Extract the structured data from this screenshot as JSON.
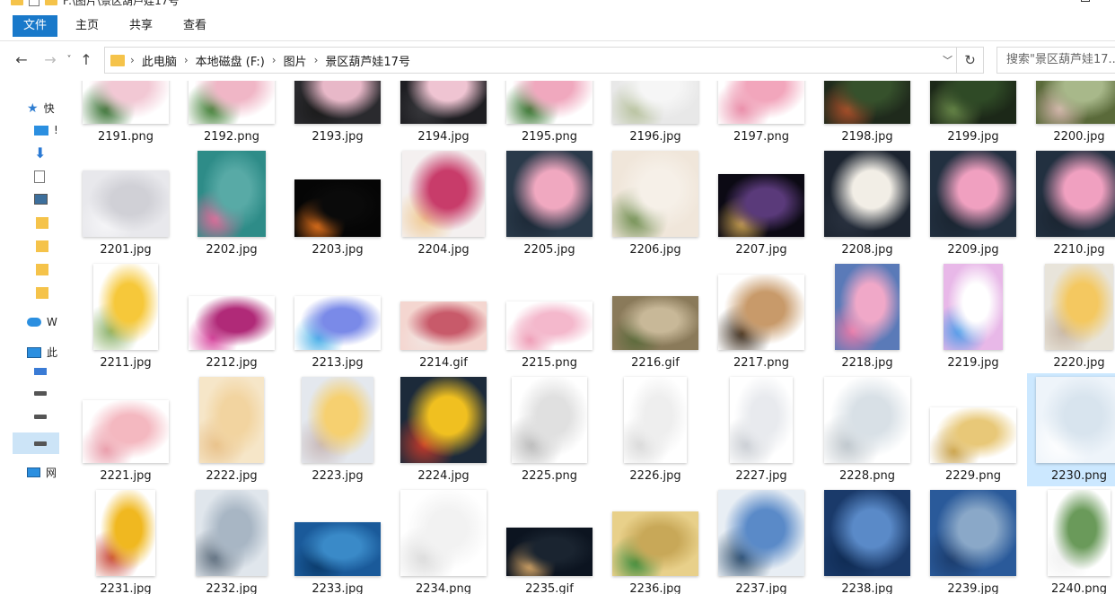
{
  "title_path": "F:\\图片\\景区葫芦娃17号",
  "ribbon": {
    "tabs": [
      "文件",
      "主页",
      "共享",
      "查看"
    ]
  },
  "nav": {
    "back": "←",
    "forward": "→",
    "recent": "˅",
    "up": "↑"
  },
  "address": {
    "crumbs": [
      "此电脑",
      "本地磁盘 (F:)",
      "图片",
      "景区葫芦娃17号"
    ],
    "dropdown_icon": "chevron-down-icon",
    "refresh_icon": "refresh-icon"
  },
  "search": {
    "placeholder": "搜索\"景区葫芦娃17..."
  },
  "sidebar": {
    "items": [
      {
        "icon": "star-icon",
        "label": "快"
      },
      {
        "icon": "desktop-icon",
        "label": "!"
      },
      {
        "icon": "download-icon",
        "label": ""
      },
      {
        "icon": "document-icon",
        "label": ""
      },
      {
        "icon": "picture-icon",
        "label": ""
      },
      {
        "icon": "folder-icon",
        "label": ""
      },
      {
        "icon": "folder-icon",
        "label": ""
      },
      {
        "icon": "folder-icon",
        "label": ""
      },
      {
        "icon": "folder-icon",
        "label": ""
      },
      {
        "icon": "cloud-icon",
        "label": "W"
      },
      {
        "icon": "pc-icon",
        "label": "此"
      },
      {
        "icon": "windows-drive-icon",
        "label": ""
      },
      {
        "icon": "drive-icon",
        "label": ""
      },
      {
        "icon": "drive-icon",
        "label": ""
      },
      {
        "icon": "drive-icon",
        "label": ""
      },
      {
        "icon": "network-icon",
        "label": "网"
      }
    ]
  },
  "files": [
    {
      "name": "2191.png",
      "colors": [
        "#ffffff",
        "#f2c8d4",
        "#2f6b2a"
      ]
    },
    {
      "name": "2192.png",
      "colors": [
        "#ffffff",
        "#f0b6c6",
        "#3a7a2e"
      ]
    },
    {
      "name": "2193.jpg",
      "colors": [
        "#2a2a2e",
        "#e8b8c8",
        "#1a1a1a"
      ]
    },
    {
      "name": "2194.jpg",
      "colors": [
        "#1e1e22",
        "#efc4d2",
        "#3a3a3e"
      ]
    },
    {
      "name": "2195.png",
      "colors": [
        "#ffffff",
        "#f0a8be",
        "#2e6e26"
      ]
    },
    {
      "name": "2196.jpg",
      "colors": [
        "#e8e8e8",
        "#f6f6f6",
        "#b5c09a"
      ]
    },
    {
      "name": "2197.png",
      "colors": [
        "#ffffff",
        "#f2a6bc",
        "#e88aa6"
      ]
    },
    {
      "name": "2198.jpg",
      "colors": [
        "#1f2a1c",
        "#36512c",
        "#b0502a"
      ]
    },
    {
      "name": "2199.jpg",
      "colors": [
        "#1c2818",
        "#2f4a26",
        "#6a8a4a"
      ]
    },
    {
      "name": "2200.jpg",
      "colors": [
        "#5a6a3a",
        "#a8b88a",
        "#d8b8b0"
      ]
    },
    {
      "name": "2201.jpg",
      "colors": [
        "#e8e8ec",
        "#d0d0d6",
        "#f6f6f8"
      ]
    },
    {
      "name": "2202.jpg",
      "colors": [
        "#2e8c88",
        "#58aaa6",
        "#e86a9a"
      ]
    },
    {
      "name": "2203.jpg",
      "colors": [
        "#050505",
        "#0a0a0a",
        "#e8741c"
      ]
    },
    {
      "name": "2204.jpg",
      "colors": [
        "#f4f0f0",
        "#c83c6a",
        "#f0c890"
      ]
    },
    {
      "name": "2205.jpg",
      "colors": [
        "#2a3a4a",
        "#f0a8c0",
        "#1c2836"
      ]
    },
    {
      "name": "2206.jpg",
      "colors": [
        "#f0e6da",
        "#f6f0e8",
        "#6a8a4a"
      ]
    },
    {
      "name": "2207.jpg",
      "colors": [
        "#0c0a14",
        "#5a3a7a",
        "#c8a050"
      ]
    },
    {
      "name": "2208.jpg",
      "colors": [
        "#1c2430",
        "#f2eee6",
        "#2a3240"
      ]
    },
    {
      "name": "2209.jpg",
      "colors": [
        "#223040",
        "#f0a0c0",
        "#1a2430"
      ]
    },
    {
      "name": "2210.jpg",
      "colors": [
        "#223040",
        "#f0a0c0",
        "#1a2430"
      ]
    },
    {
      "name": "2211.jpg",
      "colors": [
        "#ffffff",
        "#f6c83a",
        "#8ab068"
      ]
    },
    {
      "name": "2212.jpg",
      "colors": [
        "#ffffff",
        "#b02a78",
        "#d84aa0"
      ]
    },
    {
      "name": "2213.jpg",
      "colors": [
        "#ffffff",
        "#7a8ae8",
        "#4ab0e8"
      ]
    },
    {
      "name": "2214.gif",
      "colors": [
        "#f4d6d0",
        "#c85a6a",
        "#f2e4e0"
      ]
    },
    {
      "name": "2215.png",
      "colors": [
        "#ffffff",
        "#f4b8cc",
        "#ee9ab4"
      ]
    },
    {
      "name": "2216.gif",
      "colors": [
        "#8a7a5a",
        "#c8b898",
        "#5a6a3a"
      ]
    },
    {
      "name": "2217.png",
      "colors": [
        "#ffffff",
        "#c89a6a",
        "#3a2a1a"
      ]
    },
    {
      "name": "2218.jpg",
      "colors": [
        "#5a7ab8",
        "#f0a8c8",
        "#e87aa8"
      ]
    },
    {
      "name": "2219.jpg",
      "colors": [
        "#e8b8e8",
        "#ffffff",
        "#4a9ae8"
      ]
    },
    {
      "name": "2220.jpg",
      "colors": [
        "#e8e4da",
        "#f4c860",
        "#c8b8a8"
      ]
    },
    {
      "name": "2221.jpg",
      "colors": [
        "#ffffff",
        "#f4b8c0",
        "#e89aa8"
      ]
    },
    {
      "name": "2222.jpg",
      "colors": [
        "#f6e6c8",
        "#f2d4a0",
        "#e8c088"
      ]
    },
    {
      "name": "2223.jpg",
      "colors": [
        "#e4e8ee",
        "#f6d070",
        "#c8b8b8"
      ]
    },
    {
      "name": "2224.jpg",
      "colors": [
        "#1c2a3a",
        "#f0c020",
        "#c83a2a"
      ]
    },
    {
      "name": "2225.png",
      "colors": [
        "#ffffff",
        "#e0e0e0",
        "#b8b8b8"
      ]
    },
    {
      "name": "2226.jpg",
      "colors": [
        "#ffffff",
        "#eeeeee",
        "#d8d8d8"
      ]
    },
    {
      "name": "2227.jpg",
      "colors": [
        "#ffffff",
        "#e8eaee",
        "#c8ccd2"
      ]
    },
    {
      "name": "2228.png",
      "colors": [
        "#ffffff",
        "#d8e0e6",
        "#bcc4ca"
      ]
    },
    {
      "name": "2229.png",
      "colors": [
        "#ffffff",
        "#e8c878",
        "#c8a048"
      ]
    },
    {
      "name": "2230.png",
      "colors": [
        "#eef4fa",
        "#d8e4ee",
        "#ffffff"
      ]
    },
    {
      "name": "2231.jpg",
      "colors": [
        "#ffffff",
        "#f0b820",
        "#c84a3a"
      ]
    },
    {
      "name": "2232.jpg",
      "colors": [
        "#e0e6ec",
        "#a8b6c4",
        "#5a6a7a"
      ]
    },
    {
      "name": "2233.jpg",
      "colors": [
        "#1a5a9a",
        "#3a8ac8",
        "#0a3a6a"
      ]
    },
    {
      "name": "2234.png",
      "colors": [
        "#ffffff",
        "#f2f2f2",
        "#dadada"
      ]
    },
    {
      "name": "2235.gif",
      "colors": [
        "#0c1420",
        "#1a2430",
        "#d8a868"
      ]
    },
    {
      "name": "2236.jpg",
      "colors": [
        "#e8d08a",
        "#c8a858",
        "#3a8a3a"
      ]
    },
    {
      "name": "2237.jpg",
      "colors": [
        "#e8eef4",
        "#5a8ac8",
        "#2a4a6a"
      ]
    },
    {
      "name": "2238.jpg",
      "colors": [
        "#1a3a6a",
        "#5a8ac8",
        "#0e2a52"
      ]
    },
    {
      "name": "2239.jpg",
      "colors": [
        "#2a5a9a",
        "#8aa8c8",
        "#1a3a6a"
      ]
    },
    {
      "name": "2240.png",
      "colors": [
        "#ffffff",
        "#6a9a5a",
        "#f0f0f0"
      ]
    }
  ],
  "selected_file": "2230.png"
}
